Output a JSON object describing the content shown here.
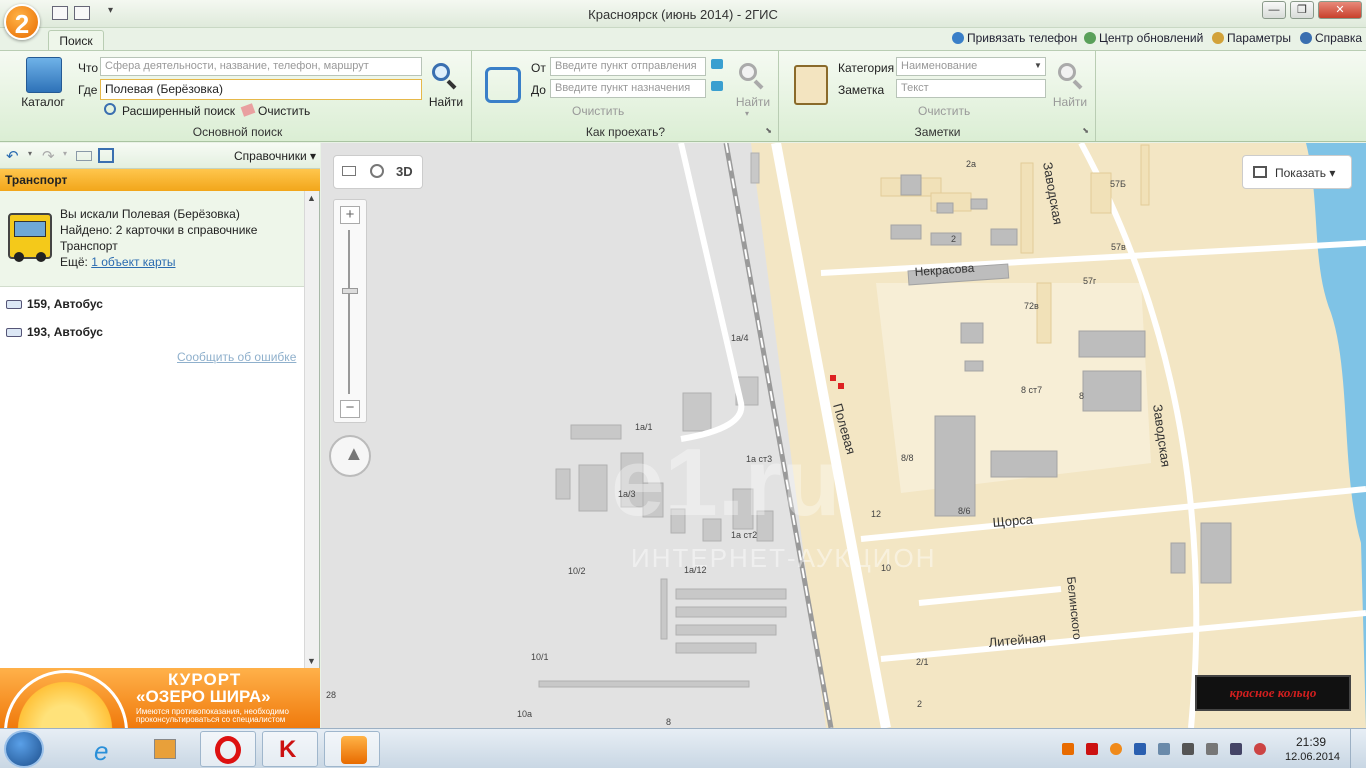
{
  "window": {
    "title": "Красноярск (июнь 2014) - 2ГИС",
    "logo_digit": "2"
  },
  "ribbon": {
    "tab_search": "Поиск",
    "top_links": {
      "bind_phone": "Привязать телефон",
      "updates": "Центр обновлений",
      "settings": "Параметры",
      "help": "Справка"
    },
    "main_search": {
      "catalog_label": "Каталог",
      "what_label": "Что",
      "what_placeholder": "Сфера деятельности, название, телефон, маршрут",
      "where_label": "Где",
      "where_value": "Полевая (Берёзовка)",
      "find_label": "Найти",
      "advanced_label": "Расширенный поиск",
      "clear_label": "Очистить",
      "group_label": "Основной поиск"
    },
    "route": {
      "from_label": "От",
      "from_placeholder": "Введите пункт отправления",
      "to_label": "До",
      "to_placeholder": "Введите пункт назначения",
      "find_label": "Найти",
      "clear_label": "Очистить",
      "group_label": "Как проехать?"
    },
    "notes": {
      "category_label": "Категория",
      "category_placeholder": "Наименование",
      "note_label": "Заметка",
      "note_placeholder": "Текст",
      "find_label": "Найти",
      "clear_label": "Очистить",
      "group_label": "Заметки"
    }
  },
  "left_panel": {
    "directories_label": "Справочники",
    "section_title": "Транспорт",
    "result": {
      "line1": "Вы искали Полевая (Берёзовка)",
      "line2": "Найдено: 2 карточки в справочнике",
      "line3": "Транспорт",
      "more_prefix": "Ещё:",
      "more_link": "1 объект карты"
    },
    "routes": [
      {
        "label": "159, Автобус"
      },
      {
        "label": "193, Автобус"
      }
    ],
    "report_error": "Сообщить об ошибке",
    "ad": {
      "title1": "КУРОРТ",
      "title2": "«ОЗЕРО ШИРА»",
      "note": "Имеются противопоказания, необходимо проконсультироваться со специалистом"
    }
  },
  "map": {
    "tool_3d": "3D",
    "show_button": "Показать",
    "ad_logo": "красное кольцо",
    "watermark_big": "e1.ru",
    "watermark_small": "ИНТЕРНЕТ-АУКЦИОН",
    "streets": {
      "polevaya": "Полевая",
      "zavodskaya_top": "Заводская",
      "zavodskaya_bottom": "Заводская",
      "nekrasova": "Некрасова",
      "shchorsa": "Щорса",
      "belinskogo": "Белинского",
      "liteynaya": "Литейная"
    },
    "labels": {
      "l_2a": "2а",
      "l_2": "2",
      "l_57b1": "57Б",
      "l_57b2": "57в",
      "l_57g": "57г",
      "l_72v": "72в",
      "l_8st7": "8 ст7",
      "l_8": "8",
      "l_8_8": "8/8",
      "l_8_6": "8/6",
      "l_12": "12",
      "l_10": "10",
      "l_2_1": "2/1",
      "l_2b": "2",
      "l_1a4": "1а/4",
      "l_1a1": "1а/1",
      "l_1ast3": "1а ст3",
      "l_1a3": "1а/3",
      "l_1ast2": "1а ст2",
      "l_1a12": "1а/12",
      "l_10_2": "10/2",
      "l_10_1": "10/1",
      "l_28": "28",
      "l_10a": "10а",
      "l_8b": "8"
    }
  },
  "taskbar": {
    "time": "21:39",
    "date": "12.06.2014"
  }
}
